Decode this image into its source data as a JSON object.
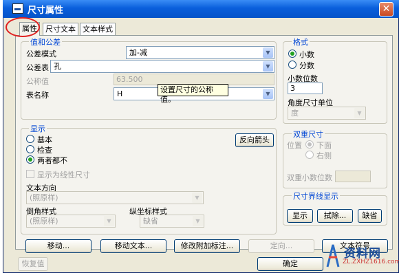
{
  "window": {
    "title": "尺寸属性",
    "close_label": "✕"
  },
  "tabs": [
    "属性",
    "尺寸文本",
    "文本样式"
  ],
  "values_group": {
    "legend": "值和公差",
    "tolerance_mode": {
      "label": "公差模式",
      "value": "加-减"
    },
    "tolerance_table": {
      "label": "公差表",
      "value": "孔"
    },
    "nominal": {
      "label": "公称值",
      "value": "63.500"
    },
    "table_name": {
      "label": "表名称",
      "value": "H"
    },
    "tooltip": "设置尺寸的公称值。"
  },
  "format_group": {
    "legend": "格式",
    "options": [
      "小数",
      "分数"
    ],
    "selected": "小数",
    "decimal_places_label": "小数位数",
    "decimal_places_value": "3",
    "angle_unit_label": "角度尺寸单位",
    "angle_unit_value": "度"
  },
  "display_group": {
    "legend": "显示",
    "options": [
      "基本",
      "检查",
      "两者都不"
    ],
    "selected": "两者都不",
    "flip_arrows_button": "反向箭头",
    "linear_checkbox": "显示为线性尺寸",
    "text_direction_label": "文本方向",
    "text_direction_value": "(照原样)",
    "chamfer_style_label": "倒角样式",
    "chamfer_style_value": "(照原样)",
    "ordinate_style_label": "纵坐标样式",
    "ordinate_style_value": "缺省"
  },
  "dual_group": {
    "legend": "双重尺寸",
    "position_label": "位置",
    "options": [
      "下面",
      "右侧"
    ],
    "selected": "下面",
    "dual_decimal_label": "双重小数位数",
    "dual_decimal_value": ""
  },
  "witness_group": {
    "legend": "尺寸界线显示",
    "buttons": [
      "显示",
      "拭除...",
      "缺省"
    ]
  },
  "bottom_buttons": [
    "移动...",
    "移动文本...",
    "修改附加标注...",
    "定向...",
    "文本符号"
  ],
  "restore_button": "恢复值",
  "ok_button": "确定",
  "watermark": {
    "name": "资料网",
    "url": "ZL.ZXHZ1616.com"
  },
  "colors": {
    "titlebar": "#0553c8",
    "legend": "#0046d5",
    "annotation_circle": "#e02020"
  }
}
